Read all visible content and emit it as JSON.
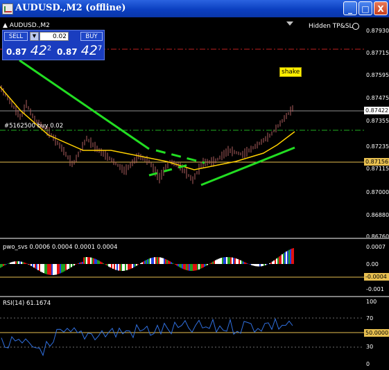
{
  "window": {
    "title": "AUDUSD.,M2 (offline)",
    "buttons": {
      "minimize": "_",
      "maximize": "□",
      "close": "X"
    }
  },
  "main_chart": {
    "symbol_label": "▲ AUDUSD.,M2",
    "hidden_tpsl": "Hidden TP&SL",
    "order_label": "#5162500 buy 0.02",
    "shake_label": "shake",
    "price_axis": [
      "0.87930",
      "0.87715",
      "0.87595",
      "0.87475",
      "0.87355",
      "0.87235",
      "0.87115",
      "0.87000",
      "0.86880",
      "0.86760"
    ],
    "current_price": "0.87422",
    "hline_price": "0.87156"
  },
  "trade_panel": {
    "sell_label": "SELL",
    "buy_label": "BUY",
    "lot": "0.02",
    "sell_price_prefix": "0.87",
    "sell_price_big": "42",
    "sell_price_sup": "2",
    "buy_price_prefix": "0.87",
    "buy_price_big": "42",
    "buy_price_sup": "7"
  },
  "pwo_panel": {
    "label": "pwo_svs 0.0006 0.0004 0.0001 0.0004",
    "axis": [
      "0.0007",
      "0.00",
      "-0.0004",
      "-0.001"
    ]
  },
  "rsi_panel": {
    "label": "RSI(14) 61.1674",
    "axis": [
      "100",
      "70",
      "50.0000",
      "30",
      "0"
    ]
  },
  "colors": {
    "price_bars": "#b06060",
    "ma_yellow": "#ffd000",
    "trend_green": "#22dd22",
    "red_dashdot": "#c02020",
    "green_dashdot": "#20b020",
    "hline": "#e8c050",
    "rsi_line": "#3070e0"
  }
}
